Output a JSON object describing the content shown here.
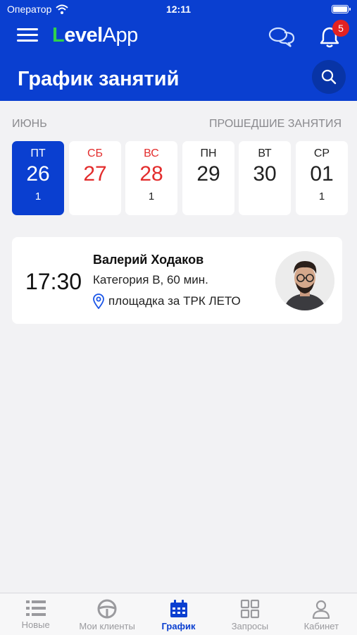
{
  "status": {
    "carrier": "Оператор",
    "time": "12:11"
  },
  "header": {
    "logo_first": "L",
    "logo_rest": "evel",
    "logo_app": "App",
    "notifications_count": "5",
    "title": "График занятий"
  },
  "schedule": {
    "month": "ИЮНЬ",
    "past_link": "ПРОШЕДШИЕ ЗАНЯТИЯ",
    "days": [
      {
        "dow": "ПТ",
        "num": "26",
        "count": "1"
      },
      {
        "dow": "СБ",
        "num": "27",
        "count": ""
      },
      {
        "dow": "ВС",
        "num": "28",
        "count": "1"
      },
      {
        "dow": "ПН",
        "num": "29",
        "count": ""
      },
      {
        "dow": "ВТ",
        "num": "30",
        "count": ""
      },
      {
        "dow": "СР",
        "num": "01",
        "count": "1"
      }
    ]
  },
  "lesson": {
    "time": "17:30",
    "name": "Валерий Ходаков",
    "category": "Категория B, 60 мин.",
    "location": "площадка за ТРК ЛЕТО"
  },
  "tabs": [
    {
      "label": "Новые"
    },
    {
      "label": "Мои клиенты"
    },
    {
      "label": "График"
    },
    {
      "label": "Запросы"
    },
    {
      "label": "Кабинет"
    }
  ],
  "colors": {
    "primary": "#0a3fd0",
    "weekend": "#e32d2d",
    "accent_logo": "#2fd14b",
    "badge": "#e32222"
  }
}
